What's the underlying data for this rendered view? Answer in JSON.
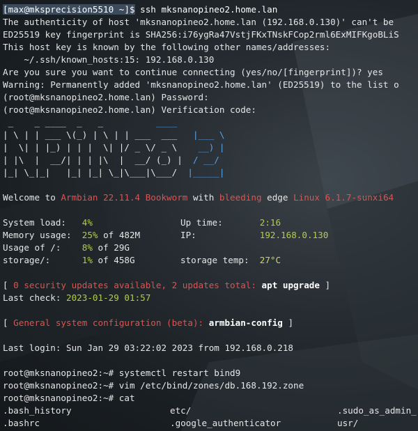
{
  "title_prompt": "[max@mksprecision5510 ~]$",
  "ssh_command": " ssh mksnanopineo2.home.lan",
  "host_auth": {
    "line1": "The authenticity of host 'mksnanopineo2.home.lan (192.168.0.130)' can't be",
    "line2": "ED25519 key fingerprint is SHA256:i76ygRa47VstjFKxTNskFCop2rml6ExMIFKgoBLiS",
    "line3": "This host key is known by the following other names/addresses:",
    "line4": "    ~/.ssh/known_hosts:15: 192.168.0.130",
    "line5": "Are you sure you want to continue connecting (yes/no/[fingerprint])? yes",
    "line6": "Warning: Permanently added 'mksnanopineo2.home.lan' (ED25519) to the list o",
    "line7": "(root@mksnanopineo2.home.lan) Password:",
    "line8": "(root@mksnanopineo2.home.lan) Verification code:"
  },
  "logo_lines": [
    {
      "white": " _    _ ____  _   _          ",
      "blue": "____  "
    },
    {
      "white": "| \\ | | ___ \\(_) | \\ | | ___  ___   ",
      "blue": "|___ \\ "
    },
    {
      "white": "|  \\| | |_) | | |  \\| |/ _ \\/ _ \\    ",
      "blue": "__) |"
    },
    {
      "white": "| |\\  |  __/| | | |\\  |  __/ (_) |  ",
      "blue": "/ __/ "
    },
    {
      "white": "|_| \\_|_|   |_| |_| \\_|\\___|\\___/  ",
      "blue": "|_____|"
    }
  ],
  "welcome": {
    "prefix": "Welcome to ",
    "os": "Armbian 22.11.4 Bookworm",
    "with": " with ",
    "bleeding": "bleeding",
    "edge": " edge ",
    "kernel": "Linux 6.1.7-sunxi64"
  },
  "stats": [
    {
      "label": "System load:   ",
      "value": "4%",
      "suffix": "",
      "label2": "Up time:       ",
      "value2": "2:16"
    },
    {
      "label": "Memory usage:  ",
      "value": "25%",
      "suffix": " of 482M",
      "label2": "IP:            ",
      "value2": "192.168.0.130"
    },
    {
      "label": "Usage of /:    ",
      "value": "8%",
      "suffix": " of 29G",
      "label2": "",
      "value2": ""
    },
    {
      "label": "storage/:      ",
      "value": "1%",
      "suffix": " of 458G",
      "label2": "storage temp:  ",
      "value2": "27°C"
    }
  ],
  "updates": {
    "open": "[ ",
    "security": "0 security updates available, 2 updates total:",
    "space": " ",
    "command": "apt upgrade",
    "close": " ]"
  },
  "last_check": {
    "label": "Last check: ",
    "value": "2023-01-29 01:57"
  },
  "config": {
    "open": "[ ",
    "label": "General system configuration (beta):",
    "space": " ",
    "command": "armbian-config",
    "close": " ]"
  },
  "last_login": "Last login: Sun Jan 29 03:22:02 2023 from 192.168.0.218",
  "commands": [
    "root@mksnanopineo2:~# systemctl restart bind9",
    "root@mksnanopineo2:~# vim /etc/bind/zones/db.168.192.zone",
    "root@mksnanopineo2:~# cat"
  ],
  "completion_rows": [
    [
      ".bash_history",
      "etc/",
      ".sudo_as_admin_"
    ],
    [
      ".bashrc",
      ".google_authenticator",
      "usr/"
    ]
  ],
  "colors": {
    "background": "#1a1f23",
    "text": "#e6e6e6",
    "red": "#e0524f",
    "green": "#b5cc4a",
    "yellow": "#d8d35e",
    "logo_blue": "#5aa3e8",
    "prompt_box": "#3b4b5c"
  }
}
